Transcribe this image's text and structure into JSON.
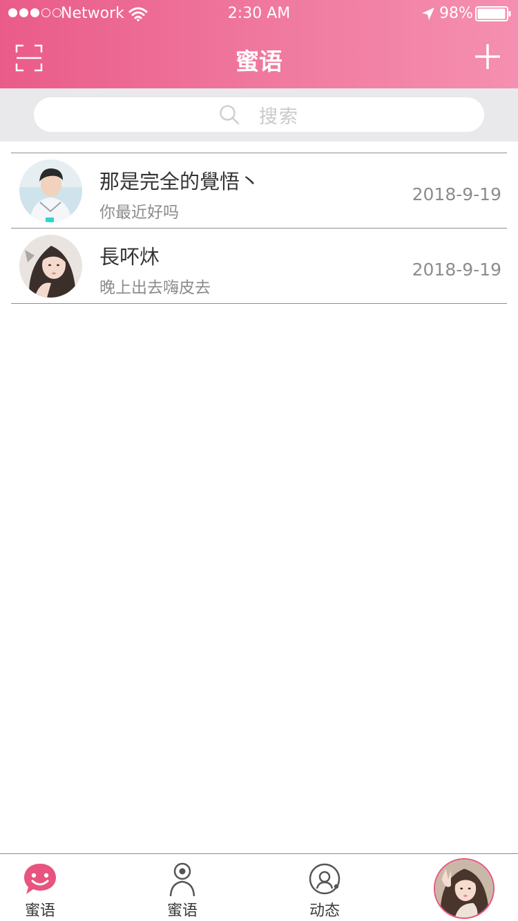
{
  "status_bar": {
    "carrier": "Network",
    "time": "2:30 AM",
    "battery": "98%"
  },
  "nav": {
    "title": "蜜语"
  },
  "search": {
    "placeholder": "搜索"
  },
  "conversations": [
    {
      "name": "那是完全的覺悟丶",
      "preview": "你最近好吗",
      "date": "2018-9-19"
    },
    {
      "name": "長吥炑",
      "preview": "晚上出去嗨皮去",
      "date": "2018-9-19"
    }
  ],
  "tabs": [
    {
      "label": "蜜语",
      "icon": "chat-bubble-icon",
      "active": true
    },
    {
      "label": "蜜语",
      "icon": "contact-icon",
      "active": false
    },
    {
      "label": "动态",
      "icon": "moments-icon",
      "active": false
    },
    {
      "label": "",
      "icon": "profile-avatar",
      "active": false
    }
  ],
  "colors": {
    "accent": "#ea5b8a",
    "accent_light": "#f58fb0",
    "search_bg": "#e9e9eb",
    "text_primary": "#333333",
    "text_secondary": "#8c8c8c"
  }
}
